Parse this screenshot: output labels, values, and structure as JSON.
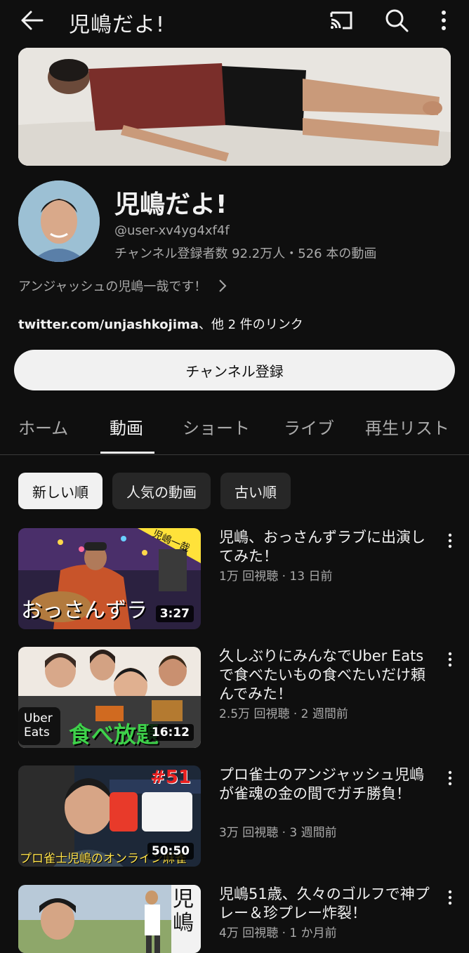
{
  "header": {
    "title": "児嶋だよ!",
    "icons": [
      "back-arrow-icon",
      "cast-icon",
      "search-icon",
      "more-vert-icon"
    ]
  },
  "channel": {
    "name": "児嶋だよ!",
    "handle": "@user-xv4yg4xf4f",
    "stats": "チャンネル登録者数 92.2万人・526 本の動画",
    "description": "アンジャッシュの児嶋一哉です！",
    "link_main": "twitter.com/unjashkojima",
    "link_rest": "、他 2 件のリンク",
    "subscribe_label": "チャンネル登録"
  },
  "tabs": [
    "ホーム",
    "動画",
    "ショート",
    "ライブ",
    "再生リスト"
  ],
  "active_tab": "動画",
  "chips": [
    "新しい順",
    "人気の動画",
    "古い順"
  ],
  "videos": [
    {
      "title": "児嶋、おっさんずラブに出演してみた！",
      "meta": "1万 回視聴 · 13 日前",
      "duration": "3:27",
      "thumb_text": "おっさんずラ",
      "thumb_tag": "児嶋一哉"
    },
    {
      "title": "久しぶりにみんなでUber Eatsで食べたいもの食べたいだけ頼んでみた！",
      "meta": "2.5万 回視聴 · 2 週間前",
      "duration": "16:12",
      "thumb_text": "食べ放題",
      "thumb_tag": "Uber Eats"
    },
    {
      "title": "プロ雀士のアンジャッシュ児嶋が雀魂の金の間でガチ勝負！",
      "meta": "3万 回視聴 · 3 週間前",
      "duration": "50:50",
      "thumb_text": "プロ雀士児嶋のオンライン麻雀",
      "thumb_tag": "#51"
    },
    {
      "title": "児嶋51歳、久々のゴルフで神プレー＆珍プレー炸裂！",
      "meta": "4万 回視聴 · 1 か月前",
      "duration": "",
      "thumb_text": "児嶋",
      "thumb_tag": ""
    }
  ],
  "colors": {
    "background": "#0f0f0f",
    "text": "#f1f1f1",
    "secondary": "#aaaaaa",
    "chip": "#272727"
  }
}
